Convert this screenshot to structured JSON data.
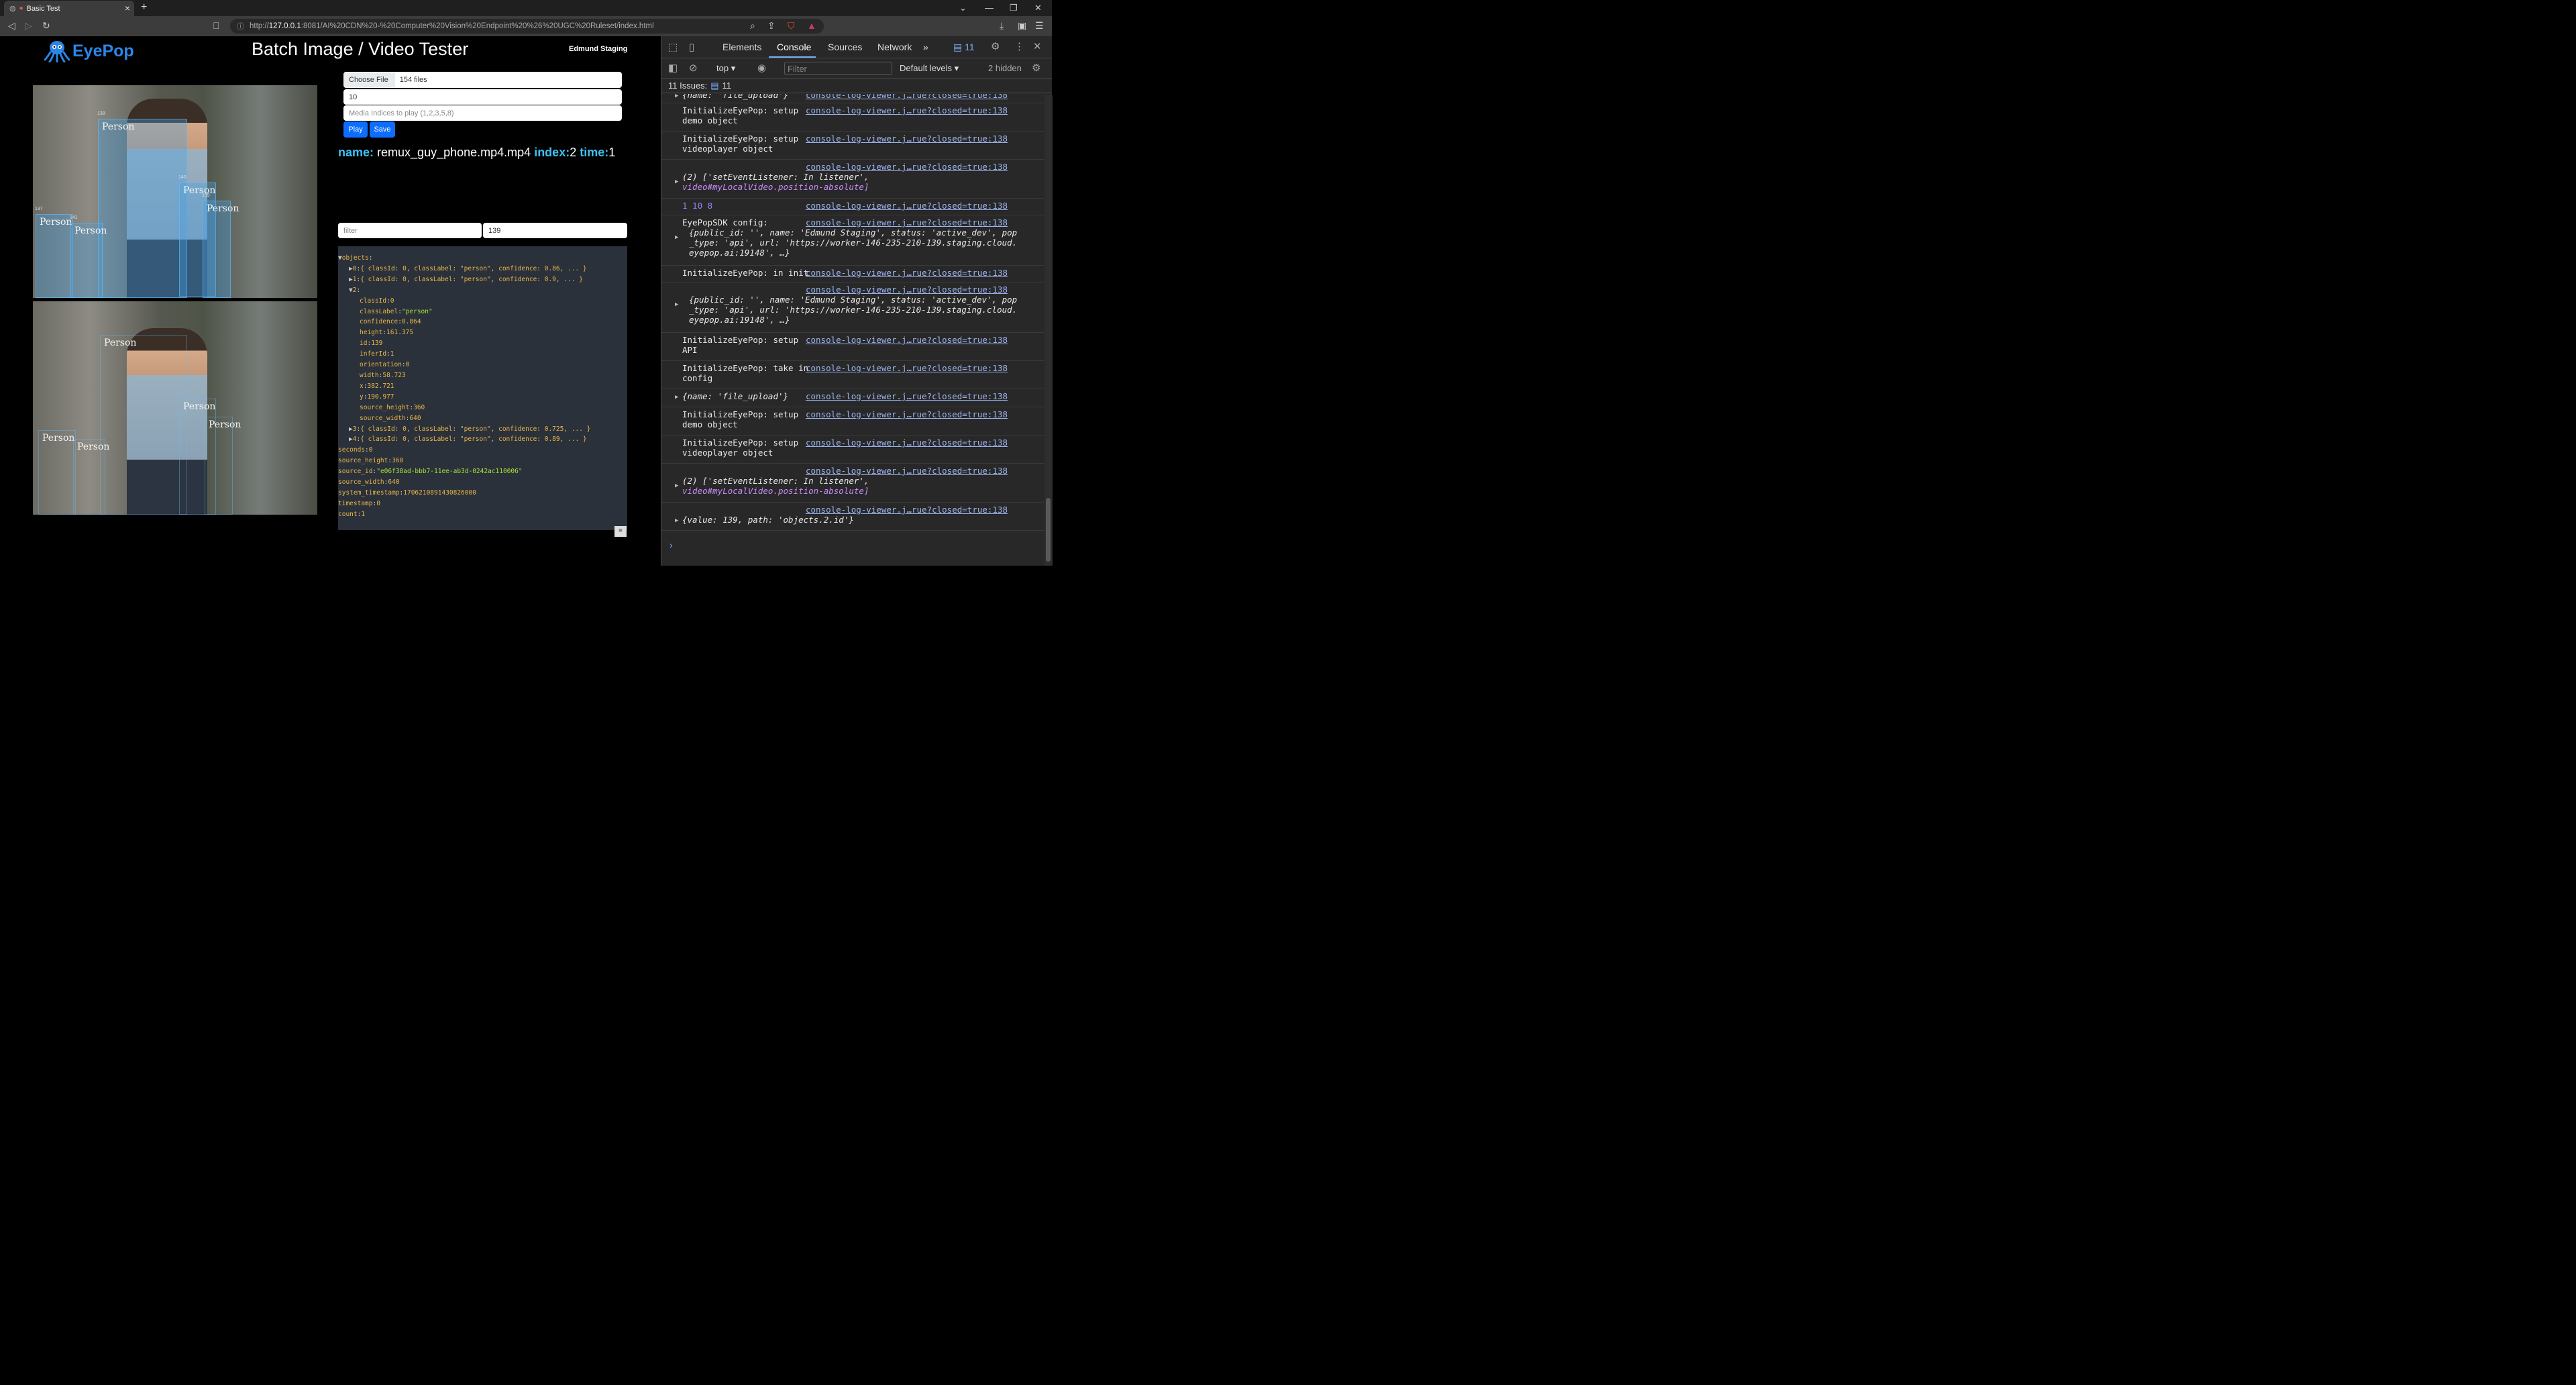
{
  "browser": {
    "tab_title": "Basic Test",
    "tab_close": "×",
    "new_tab": "+",
    "url_host": "127.0.0.1",
    "url_prefix": "http://",
    "url_rest": ":8081/AI%20CDN%20-%20Computer%20Vision%20Endpoint%20%26%20UGC%20Ruleset/index.html"
  },
  "page": {
    "logo_text": "EyePop",
    "title": "Batch Image / Video Tester",
    "env_label": "Edmund Staging",
    "choose_file_label": "Choose File",
    "file_count": "154 files",
    "count_value": "10",
    "indices_placeholder": "Media Indices to play (1,2,3,5,8)",
    "play_label": "Play",
    "save_label": "Save",
    "info": {
      "name_key": "name:",
      "name_value": "remux_guy_phone.mp4.mp4",
      "index_key": "index:",
      "index_value": "2",
      "time_key": "time:",
      "time_value": "1"
    },
    "filter_placeholder": "filter",
    "filter_value": "139",
    "json_toggle": "≡",
    "bbox_label": "Person",
    "top_box_ids": [
      "138",
      "140",
      "137",
      "139",
      "141"
    ]
  },
  "json_tree": [
    {
      "indent": 0,
      "toggle": "▼",
      "key": "objects",
      "sep": ":",
      "val": "",
      "vtype": ""
    },
    {
      "indent": 1,
      "toggle": "▶",
      "key": "0",
      "sep": ":",
      "val": "{ classId: 0, classLabel: \"person\", confidence: 0.86, ... }",
      "vtype": "p"
    },
    {
      "indent": 1,
      "toggle": "▶",
      "key": "1",
      "sep": ":",
      "val": "{ classId: 0, classLabel: \"person\", confidence: 0.9, ... }",
      "vtype": "p"
    },
    {
      "indent": 1,
      "toggle": "▼",
      "key": "2",
      "sep": ":",
      "val": "",
      "vtype": ""
    },
    {
      "indent": 2,
      "toggle": "",
      "key": "classId",
      "sep": ":",
      "val": "0",
      "vtype": "n"
    },
    {
      "indent": 2,
      "toggle": "",
      "key": "classLabel",
      "sep": ":",
      "val": "\"person\"",
      "vtype": "s"
    },
    {
      "indent": 2,
      "toggle": "",
      "key": "confidence",
      "sep": ":",
      "val": "0.864",
      "vtype": "n"
    },
    {
      "indent": 2,
      "toggle": "",
      "key": "height",
      "sep": ":",
      "val": "161.375",
      "vtype": "n"
    },
    {
      "indent": 2,
      "toggle": "",
      "key": "id",
      "sep": ":",
      "val": "139",
      "vtype": "n"
    },
    {
      "indent": 2,
      "toggle": "",
      "key": "inferId",
      "sep": ":",
      "val": "1",
      "vtype": "n"
    },
    {
      "indent": 2,
      "toggle": "",
      "key": "orientation",
      "sep": ":",
      "val": "0",
      "vtype": "n"
    },
    {
      "indent": 2,
      "toggle": "",
      "key": "width",
      "sep": ":",
      "val": "58.723",
      "vtype": "n"
    },
    {
      "indent": 2,
      "toggle": "",
      "key": "x",
      "sep": ":",
      "val": "382.721",
      "vtype": "n"
    },
    {
      "indent": 2,
      "toggle": "",
      "key": "y",
      "sep": ":",
      "val": "190.977",
      "vtype": "n"
    },
    {
      "indent": 2,
      "toggle": "",
      "key": "source_height",
      "sep": ":",
      "val": "360",
      "vtype": "n"
    },
    {
      "indent": 2,
      "toggle": "",
      "key": "source_width",
      "sep": ":",
      "val": "640",
      "vtype": "n"
    },
    {
      "indent": 1,
      "toggle": "▶",
      "key": "3",
      "sep": ":",
      "val": "{ classId: 0, classLabel: \"person\", confidence: 0.725, ... }",
      "vtype": "p"
    },
    {
      "indent": 1,
      "toggle": "▶",
      "key": "4",
      "sep": ":",
      "val": "{ classId: 0, classLabel: \"person\", confidence: 0.89, ... }",
      "vtype": "p"
    },
    {
      "indent": 0,
      "toggle": "",
      "key": "seconds",
      "sep": ":",
      "val": "0",
      "vtype": "n"
    },
    {
      "indent": 0,
      "toggle": "",
      "key": "source_height",
      "sep": ":",
      "val": "360",
      "vtype": "n"
    },
    {
      "indent": 0,
      "toggle": "",
      "key": "source_id",
      "sep": ":",
      "val": "\"e06f38ad-bbb7-11ee-ab3d-0242ac110006\"",
      "vtype": "s"
    },
    {
      "indent": 0,
      "toggle": "",
      "key": "source_width",
      "sep": ":",
      "val": "640",
      "vtype": "n"
    },
    {
      "indent": 0,
      "toggle": "",
      "key": "system_timestamp",
      "sep": ":",
      "val": "1706210891430826000",
      "vtype": "n"
    },
    {
      "indent": 0,
      "toggle": "",
      "key": "timestamp",
      "sep": ":",
      "val": "0",
      "vtype": "n"
    },
    {
      "indent": 0,
      "toggle": "",
      "key": "count",
      "sep": ":",
      "val": "1",
      "vtype": "n"
    }
  ],
  "devtools": {
    "tabs": [
      "Elements",
      "Console",
      "Sources",
      "Network"
    ],
    "more": "»",
    "issues_badge": "11",
    "context": "top",
    "filter_placeholder": "Filter",
    "levels": "Default levels",
    "hidden": "2 hidden",
    "issues_line_label": "11 Issues:",
    "issues_line_count": "11",
    "source_link": "console-log-viewer.j…rue?closed=true:138",
    "prompt": "›"
  },
  "console_text": {
    "partial_top": "{name: 'file_upload'}",
    "setup_demo": "InitializeEyePop: setup demo object",
    "setup_videoplayer": "InitializeEyePop: setup videoplayer object",
    "listener_line1": "(2) ['setEventListener: In listener',",
    "listener_line2": "video#myLocalVideo.position-absolute]",
    "numbers": "1 10 8",
    "sdk_config": "EyePopSDK config:",
    "config_obj_line1": "{public_id: '', name: 'Edmund Staging', status: 'active_dev', pop",
    "config_obj_line2": "_type: 'api', url: 'https://worker-146-235-210-139.staging.cloud.",
    "config_obj_line3": "eyepop.ai:19148', …}",
    "in_init": "InitializeEyePop: in init",
    "setup_api": "InitializeEyePop: setup API",
    "take_config": "InitializeEyePop: take in config",
    "file_upload": "{name: 'file_upload'}",
    "value_path": "{value: 139, path: 'objects.2.id'}"
  }
}
